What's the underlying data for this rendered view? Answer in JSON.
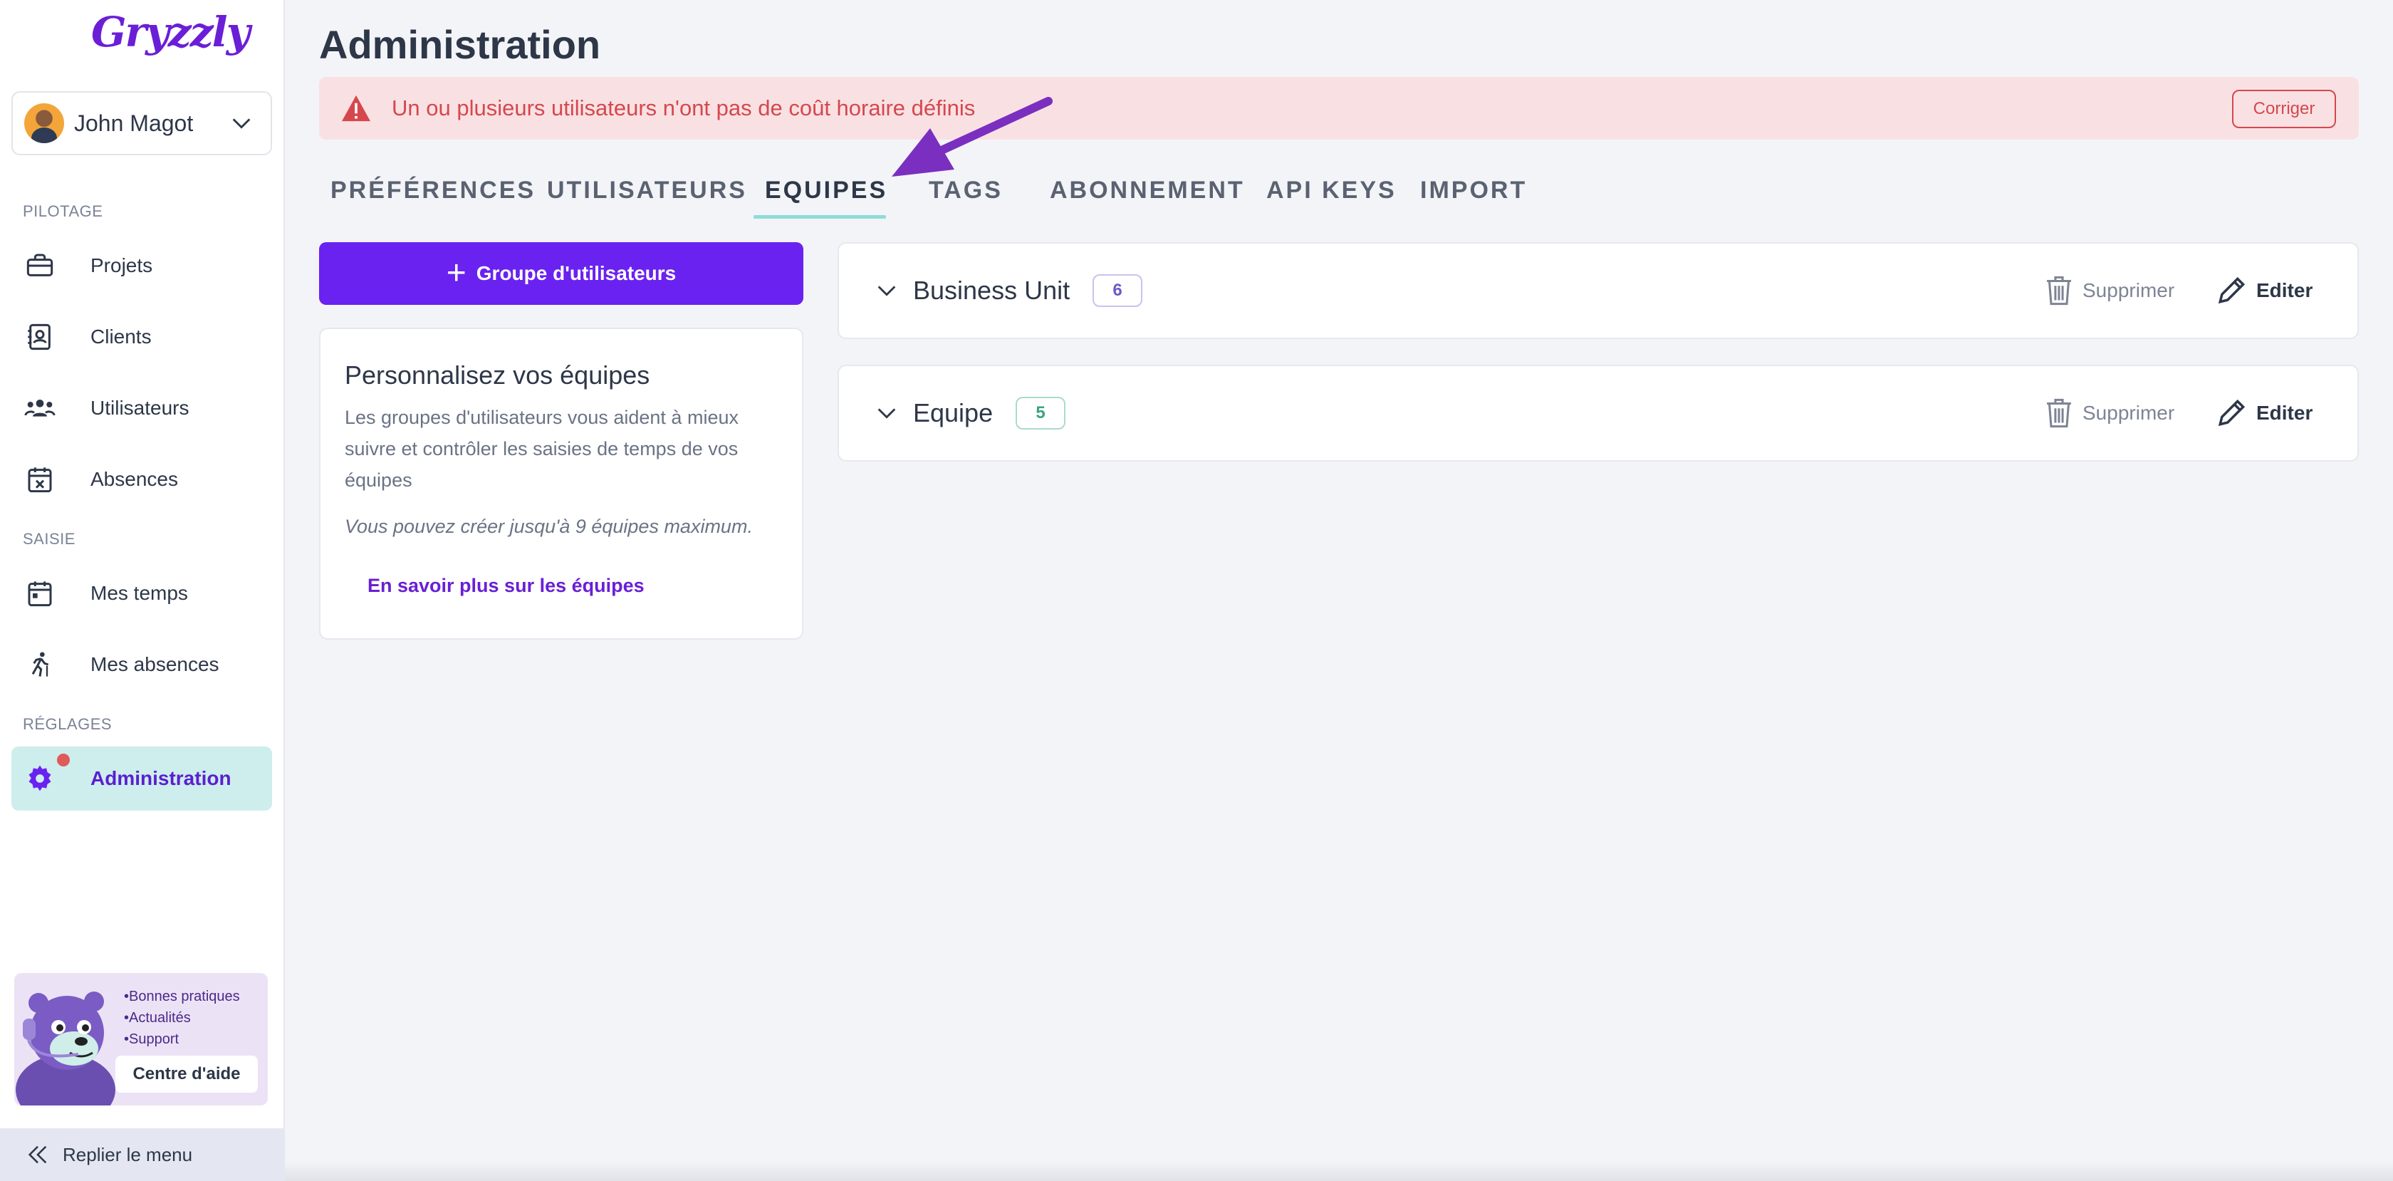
{
  "app": {
    "logo_text": "Gryzzly"
  },
  "user": {
    "name": "John Magot"
  },
  "sidebar": {
    "sections": [
      {
        "label": "PILOTAGE"
      },
      {
        "label": "SAISIE"
      },
      {
        "label": "RÉGLAGES"
      }
    ],
    "items": [
      {
        "label": "Projets",
        "icon": "briefcase-icon"
      },
      {
        "label": "Clients",
        "icon": "contact-card-icon"
      },
      {
        "label": "Utilisateurs",
        "icon": "users-icon"
      },
      {
        "label": "Absences",
        "icon": "calendar-x-icon"
      },
      {
        "label": "Mes temps",
        "icon": "calendar-icon"
      },
      {
        "label": "Mes absences",
        "icon": "walking-person-icon"
      },
      {
        "label": "Administration",
        "icon": "gear-icon",
        "active": true
      }
    ],
    "help": {
      "links": [
        "•Bonnes pratiques",
        "•Actualités",
        "•Support"
      ],
      "button_label": "Centre d'aide"
    },
    "collapse_label": "Replier le menu"
  },
  "main": {
    "title": "Administration",
    "alert": {
      "text": "Un ou plusieurs utilisateurs n'ont pas de coût horaire définis",
      "button_label": "Corriger"
    },
    "tabs": [
      {
        "label": "PRÉFÉRENCES"
      },
      {
        "label": "UTILISATEURS"
      },
      {
        "label": "EQUIPES",
        "active": true
      },
      {
        "label": "TAGS"
      },
      {
        "label": "ABONNEMENT"
      },
      {
        "label": "API KEYS"
      },
      {
        "label": "IMPORT"
      }
    ],
    "add_group_label": "Groupe d'utilisateurs",
    "info_card": {
      "title": "Personnalisez vos équipes",
      "description": "Les groupes d'utilisateurs vous aident à mieux suivre et contrôler les saisies de temps de vos équipes",
      "note": "Vous pouvez créer jusqu'à 9 équipes maximum.",
      "link": "En savoir plus sur les équipes"
    },
    "groups": [
      {
        "name": "Business Unit",
        "count": "6",
        "badge_color": "#6a5acd",
        "badge_border": "#c9c3ee"
      },
      {
        "name": "Equipe",
        "count": "5",
        "badge_color": "#3aa57a",
        "badge_border": "#a9dcc6"
      }
    ],
    "row_actions": {
      "delete_label": "Supprimer",
      "edit_label": "Editer"
    }
  },
  "colors": {
    "accent": "#6a22f0",
    "active_nav_bg": "#cdeeed",
    "alert_bg": "#f9e1e3",
    "alert_text": "#d6474d",
    "annotation_arrow": "#7a2fc0"
  }
}
